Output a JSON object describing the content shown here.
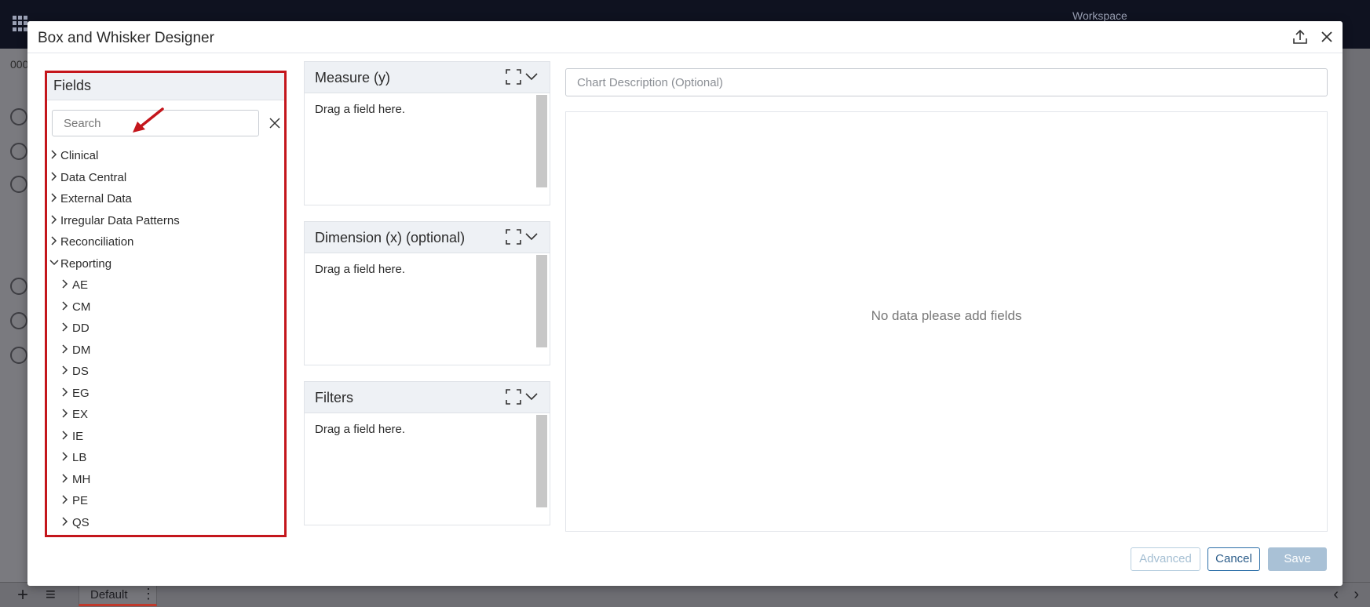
{
  "background": {
    "workspace_label": "Workspace",
    "left_code": "000",
    "bottom_tab": "Default"
  },
  "modal": {
    "title": "Box and Whisker Designer",
    "icons": {
      "export": "export-upload-icon",
      "close": "close-icon"
    }
  },
  "fields": {
    "title": "Fields",
    "search_placeholder": "Search",
    "tree": [
      {
        "label": "Clinical",
        "level": 0,
        "expanded": false
      },
      {
        "label": "Data Central",
        "level": 0,
        "expanded": false
      },
      {
        "label": "External Data",
        "level": 0,
        "expanded": false
      },
      {
        "label": "Irregular Data Patterns",
        "level": 0,
        "expanded": false
      },
      {
        "label": "Reconciliation",
        "level": 0,
        "expanded": false
      },
      {
        "label": "Reporting",
        "level": 0,
        "expanded": true
      },
      {
        "label": "AE",
        "level": 1,
        "expanded": false
      },
      {
        "label": "CM",
        "level": 1,
        "expanded": false
      },
      {
        "label": "DD",
        "level": 1,
        "expanded": false
      },
      {
        "label": "DM",
        "level": 1,
        "expanded": false
      },
      {
        "label": "DS",
        "level": 1,
        "expanded": false
      },
      {
        "label": "EG",
        "level": 1,
        "expanded": false
      },
      {
        "label": "EX",
        "level": 1,
        "expanded": false
      },
      {
        "label": "IE",
        "level": 1,
        "expanded": false
      },
      {
        "label": "LB",
        "level": 1,
        "expanded": false
      },
      {
        "label": "MH",
        "level": 1,
        "expanded": false
      },
      {
        "label": "PE",
        "level": 1,
        "expanded": false
      },
      {
        "label": "QS",
        "level": 1,
        "expanded": false
      }
    ]
  },
  "zones": {
    "measure": {
      "title": "Measure (y)",
      "hint": "Drag a field here."
    },
    "dimension": {
      "title": "Dimension (x) (optional)",
      "hint": "Drag a field here."
    },
    "filters": {
      "title": "Filters",
      "hint": "Drag a field here."
    }
  },
  "description": {
    "placeholder": "Chart Description (Optional)"
  },
  "preview": {
    "empty_text": "No data please add fields"
  },
  "buttons": {
    "advanced": "Advanced",
    "cancel": "Cancel",
    "save": "Save"
  },
  "colors": {
    "highlight": "#c4161c",
    "accent": "#2c6fa8",
    "disabled": "#a9c1d6"
  }
}
